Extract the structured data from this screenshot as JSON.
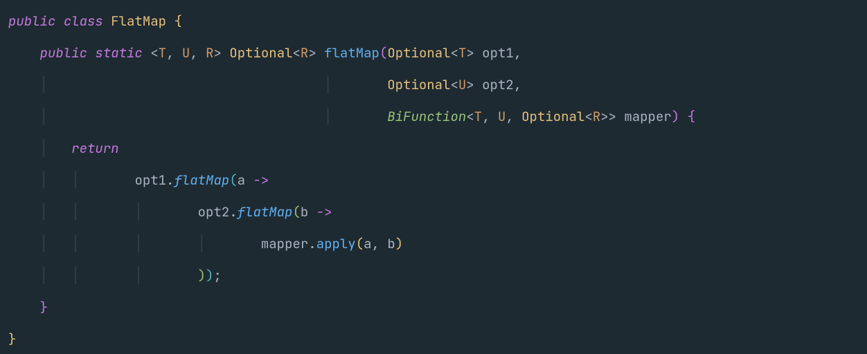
{
  "language": "java",
  "colors": {
    "background": "#1e2a32",
    "keyword": "#c678dd",
    "type": "#e5c07b",
    "method": "#61afef",
    "typeParam": "#d19a66",
    "punctuation": "#abb2bf",
    "identifier": "#abb2bf",
    "typeItalic": "#98c379",
    "bracketYellow": "#e5c07b",
    "bracketPurple": "#c678dd",
    "bracketBlue": "#56b6c2",
    "bracketGreen": "#98c379",
    "indentGuide": "rgba(171,178,191,0.15)"
  },
  "code": {
    "l1": {
      "kw_public": "public",
      "kw_class": "class",
      "classname": "FlatMap",
      "brace_open": "{"
    },
    "l2": {
      "kw_public": "public",
      "kw_static": "static",
      "lt1": "<",
      "tp_T": "T",
      "c1": ",",
      "tp_U": "U",
      "c2": ",",
      "tp_R": "R",
      "gt1": ">",
      "ret_type": "Optional",
      "lt2": "<",
      "tp_R2": "R",
      "gt2": ">",
      "methodname": "flatMap",
      "paren_open": "(",
      "p1_type": "Optional",
      "lt3": "<",
      "tp_T2": "T",
      "gt3": ">",
      "p1_name": "opt1",
      "comma": ","
    },
    "l3": {
      "p2_type": "Optional",
      "lt": "<",
      "tp_U": "U",
      "gt": ">",
      "p2_name": "opt2",
      "comma": ","
    },
    "l4": {
      "p3_type": "BiFunction",
      "lt1": "<",
      "tp_T": "T",
      "c1": ",",
      "tp_U": "U",
      "c2": ",",
      "inner_type": "Optional",
      "lt2": "<",
      "tp_R": "R",
      "gt2": ">",
      "gt1": ">",
      "p3_name": "mapper",
      "paren_close": ")",
      "brace_open": "{"
    },
    "l5": {
      "kw_return": "return"
    },
    "l6": {
      "obj": "opt1",
      "dot": ".",
      "method": "flatMap",
      "paren_open": "(",
      "param": "a",
      "arrow": "->"
    },
    "l7": {
      "obj": "opt2",
      "dot": ".",
      "method": "flatMap",
      "paren_open": "(",
      "param": "b",
      "arrow": "->"
    },
    "l8": {
      "obj": "mapper",
      "dot": ".",
      "method": "apply",
      "paren_open": "(",
      "arg1": "a",
      "comma": ",",
      "arg2": "b",
      "paren_close": ")"
    },
    "l9": {
      "close1": ")",
      "close2": ")",
      "semi": ";"
    },
    "l10": {
      "brace_close": "}"
    },
    "l11": {
      "brace_close": "}"
    }
  }
}
